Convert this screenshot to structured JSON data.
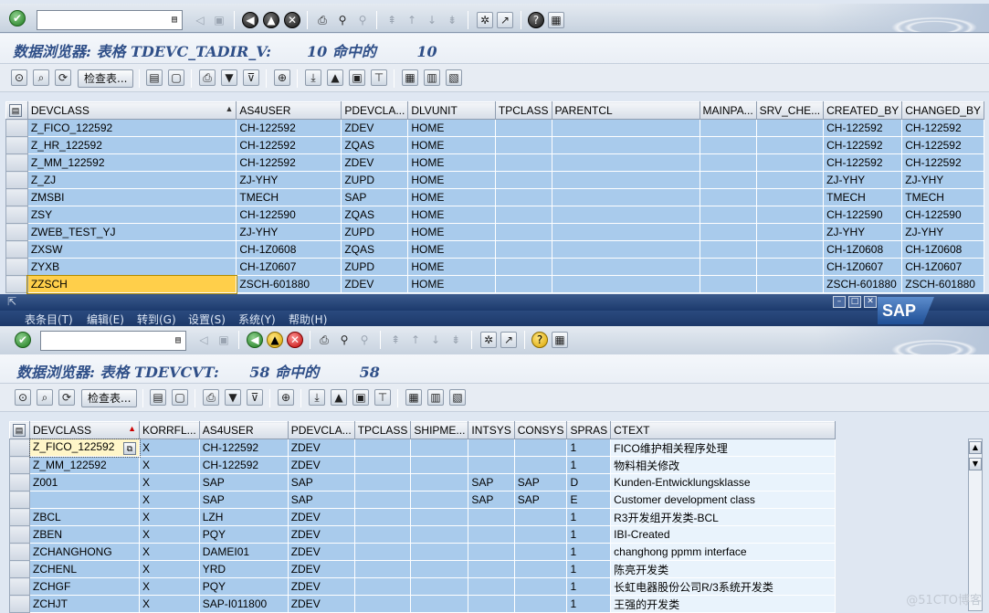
{
  "top": {
    "title": "数据浏览器: 表格 TDEVC_TADIR_V:       10 命中的        10",
    "check_table_label": "检查表...",
    "grid": {
      "columns": [
        "DEVCLASS",
        "AS4USER",
        "PDEVCLA...",
        "DLVUNIT",
        "TPCLASS",
        "PARENTCL",
        "MAINPA...",
        "SRV_CHE...",
        "CREATED_BY",
        "CHANGED_BY"
      ],
      "rows": [
        [
          "Z_FICO_122592",
          "CH-122592",
          "ZDEV",
          "HOME",
          "",
          "",
          "",
          "",
          "CH-122592",
          "CH-122592"
        ],
        [
          "Z_HR_122592",
          "CH-122592",
          "ZQAS",
          "HOME",
          "",
          "",
          "",
          "",
          "CH-122592",
          "CH-122592"
        ],
        [
          "Z_MM_122592",
          "CH-122592",
          "ZDEV",
          "HOME",
          "",
          "",
          "",
          "",
          "CH-122592",
          "CH-122592"
        ],
        [
          "Z_ZJ",
          "ZJ-YHY",
          "ZUPD",
          "HOME",
          "",
          "",
          "",
          "",
          "ZJ-YHY",
          "ZJ-YHY"
        ],
        [
          "ZMSBI",
          "TMECH",
          "SAP",
          "HOME",
          "",
          "",
          "",
          "",
          "TMECH",
          "TMECH"
        ],
        [
          "ZSY",
          "CH-122590",
          "ZQAS",
          "HOME",
          "",
          "",
          "",
          "",
          "CH-122590",
          "CH-122590"
        ],
        [
          "ZWEB_TEST_YJ",
          "ZJ-YHY",
          "ZUPD",
          "HOME",
          "",
          "",
          "",
          "",
          "ZJ-YHY",
          "ZJ-YHY"
        ],
        [
          "ZXSW",
          "CH-1Z0608",
          "ZQAS",
          "HOME",
          "",
          "",
          "",
          "",
          "CH-1Z0608",
          "CH-1Z0608"
        ],
        [
          "ZYXB",
          "CH-1Z0607",
          "ZUPD",
          "HOME",
          "",
          "",
          "",
          "",
          "CH-1Z0607",
          "CH-1Z0607"
        ],
        [
          "ZZSCH",
          "ZSCH-601880",
          "ZDEV",
          "HOME",
          "",
          "",
          "",
          "",
          "ZSCH-601880",
          "ZSCH-601880"
        ]
      ]
    }
  },
  "menu": [
    "表条目(T)",
    "编辑(E)",
    "转到(G)",
    "设置(S)",
    "系统(Y)",
    "帮助(H)"
  ],
  "sap_logo": "SAP",
  "bottom": {
    "title": "数据浏览器: 表格 TDEVCVT:      58 命中的        58",
    "check_table_label": "检查表...",
    "grid": {
      "columns": [
        "DEVCLASS",
        "KORRFL...",
        "AS4USER",
        "PDEVCLA...",
        "TPCLASS",
        "SHIPME...",
        "INTSYS",
        "CONSYS",
        "SPRAS",
        "CTEXT"
      ],
      "rows": [
        [
          "Z_FICO_122592",
          "X",
          "CH-122592",
          "ZDEV",
          "",
          "",
          "",
          "",
          "1",
          "FICO维护相关程序处理"
        ],
        [
          "Z_MM_122592",
          "X",
          "CH-122592",
          "ZDEV",
          "",
          "",
          "",
          "",
          "1",
          "物料相关修改"
        ],
        [
          "Z001",
          "X",
          "SAP",
          "SAP",
          "",
          "",
          "SAP",
          "SAP",
          "D",
          "Kunden-Entwicklungsklasse"
        ],
        [
          "",
          "X",
          "SAP",
          "SAP",
          "",
          "",
          "SAP",
          "SAP",
          "E",
          "Customer development class"
        ],
        [
          "ZBCL",
          "X",
          "LZH",
          "ZDEV",
          "",
          "",
          "",
          "",
          "1",
          "R3开发组开发类-BCL"
        ],
        [
          "ZBEN",
          "X",
          "PQY",
          "ZDEV",
          "",
          "",
          "",
          "",
          "1",
          "IBI-Created"
        ],
        [
          "ZCHANGHONG",
          "X",
          "DAMEI01",
          "ZDEV",
          "",
          "",
          "",
          "",
          "1",
          "changhong ppmm interface"
        ],
        [
          "ZCHENL",
          "X",
          "YRD",
          "ZDEV",
          "",
          "",
          "",
          "",
          "1",
          "陈亮开发类"
        ],
        [
          "ZCHGF",
          "X",
          "PQY",
          "ZDEV",
          "",
          "",
          "",
          "",
          "1",
          "长虹电器股份公司R/3系统开发类"
        ],
        [
          "ZCHJT",
          "X",
          "SAP-I011800",
          "ZDEV",
          "",
          "",
          "",
          "",
          "1",
          "王强的开发类"
        ]
      ]
    }
  },
  "watermark": "@51CTO博客"
}
